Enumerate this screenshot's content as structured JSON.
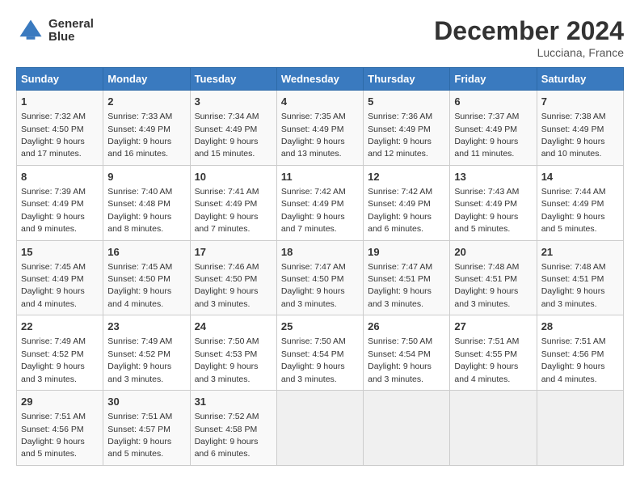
{
  "header": {
    "logo_line1": "General",
    "logo_line2": "Blue",
    "month": "December 2024",
    "location": "Lucciana, France"
  },
  "columns": [
    "Sunday",
    "Monday",
    "Tuesday",
    "Wednesday",
    "Thursday",
    "Friday",
    "Saturday"
  ],
  "weeks": [
    [
      {
        "day": "1",
        "info": "Sunrise: 7:32 AM\nSunset: 4:50 PM\nDaylight: 9 hours\nand 17 minutes."
      },
      {
        "day": "2",
        "info": "Sunrise: 7:33 AM\nSunset: 4:49 PM\nDaylight: 9 hours\nand 16 minutes."
      },
      {
        "day": "3",
        "info": "Sunrise: 7:34 AM\nSunset: 4:49 PM\nDaylight: 9 hours\nand 15 minutes."
      },
      {
        "day": "4",
        "info": "Sunrise: 7:35 AM\nSunset: 4:49 PM\nDaylight: 9 hours\nand 13 minutes."
      },
      {
        "day": "5",
        "info": "Sunrise: 7:36 AM\nSunset: 4:49 PM\nDaylight: 9 hours\nand 12 minutes."
      },
      {
        "day": "6",
        "info": "Sunrise: 7:37 AM\nSunset: 4:49 PM\nDaylight: 9 hours\nand 11 minutes."
      },
      {
        "day": "7",
        "info": "Sunrise: 7:38 AM\nSunset: 4:49 PM\nDaylight: 9 hours\nand 10 minutes."
      }
    ],
    [
      {
        "day": "8",
        "info": "Sunrise: 7:39 AM\nSunset: 4:49 PM\nDaylight: 9 hours\nand 9 minutes."
      },
      {
        "day": "9",
        "info": "Sunrise: 7:40 AM\nSunset: 4:48 PM\nDaylight: 9 hours\nand 8 minutes."
      },
      {
        "day": "10",
        "info": "Sunrise: 7:41 AM\nSunset: 4:49 PM\nDaylight: 9 hours\nand 7 minutes."
      },
      {
        "day": "11",
        "info": "Sunrise: 7:42 AM\nSunset: 4:49 PM\nDaylight: 9 hours\nand 7 minutes."
      },
      {
        "day": "12",
        "info": "Sunrise: 7:42 AM\nSunset: 4:49 PM\nDaylight: 9 hours\nand 6 minutes."
      },
      {
        "day": "13",
        "info": "Sunrise: 7:43 AM\nSunset: 4:49 PM\nDaylight: 9 hours\nand 5 minutes."
      },
      {
        "day": "14",
        "info": "Sunrise: 7:44 AM\nSunset: 4:49 PM\nDaylight: 9 hours\nand 5 minutes."
      }
    ],
    [
      {
        "day": "15",
        "info": "Sunrise: 7:45 AM\nSunset: 4:49 PM\nDaylight: 9 hours\nand 4 minutes."
      },
      {
        "day": "16",
        "info": "Sunrise: 7:45 AM\nSunset: 4:50 PM\nDaylight: 9 hours\nand 4 minutes."
      },
      {
        "day": "17",
        "info": "Sunrise: 7:46 AM\nSunset: 4:50 PM\nDaylight: 9 hours\nand 3 minutes."
      },
      {
        "day": "18",
        "info": "Sunrise: 7:47 AM\nSunset: 4:50 PM\nDaylight: 9 hours\nand 3 minutes."
      },
      {
        "day": "19",
        "info": "Sunrise: 7:47 AM\nSunset: 4:51 PM\nDaylight: 9 hours\nand 3 minutes."
      },
      {
        "day": "20",
        "info": "Sunrise: 7:48 AM\nSunset: 4:51 PM\nDaylight: 9 hours\nand 3 minutes."
      },
      {
        "day": "21",
        "info": "Sunrise: 7:48 AM\nSunset: 4:51 PM\nDaylight: 9 hours\nand 3 minutes."
      }
    ],
    [
      {
        "day": "22",
        "info": "Sunrise: 7:49 AM\nSunset: 4:52 PM\nDaylight: 9 hours\nand 3 minutes."
      },
      {
        "day": "23",
        "info": "Sunrise: 7:49 AM\nSunset: 4:52 PM\nDaylight: 9 hours\nand 3 minutes."
      },
      {
        "day": "24",
        "info": "Sunrise: 7:50 AM\nSunset: 4:53 PM\nDaylight: 9 hours\nand 3 minutes."
      },
      {
        "day": "25",
        "info": "Sunrise: 7:50 AM\nSunset: 4:54 PM\nDaylight: 9 hours\nand 3 minutes."
      },
      {
        "day": "26",
        "info": "Sunrise: 7:50 AM\nSunset: 4:54 PM\nDaylight: 9 hours\nand 3 minutes."
      },
      {
        "day": "27",
        "info": "Sunrise: 7:51 AM\nSunset: 4:55 PM\nDaylight: 9 hours\nand 4 minutes."
      },
      {
        "day": "28",
        "info": "Sunrise: 7:51 AM\nSunset: 4:56 PM\nDaylight: 9 hours\nand 4 minutes."
      }
    ],
    [
      {
        "day": "29",
        "info": "Sunrise: 7:51 AM\nSunset: 4:56 PM\nDaylight: 9 hours\nand 5 minutes."
      },
      {
        "day": "30",
        "info": "Sunrise: 7:51 AM\nSunset: 4:57 PM\nDaylight: 9 hours\nand 5 minutes."
      },
      {
        "day": "31",
        "info": "Sunrise: 7:52 AM\nSunset: 4:58 PM\nDaylight: 9 hours\nand 6 minutes."
      },
      null,
      null,
      null,
      null
    ]
  ]
}
